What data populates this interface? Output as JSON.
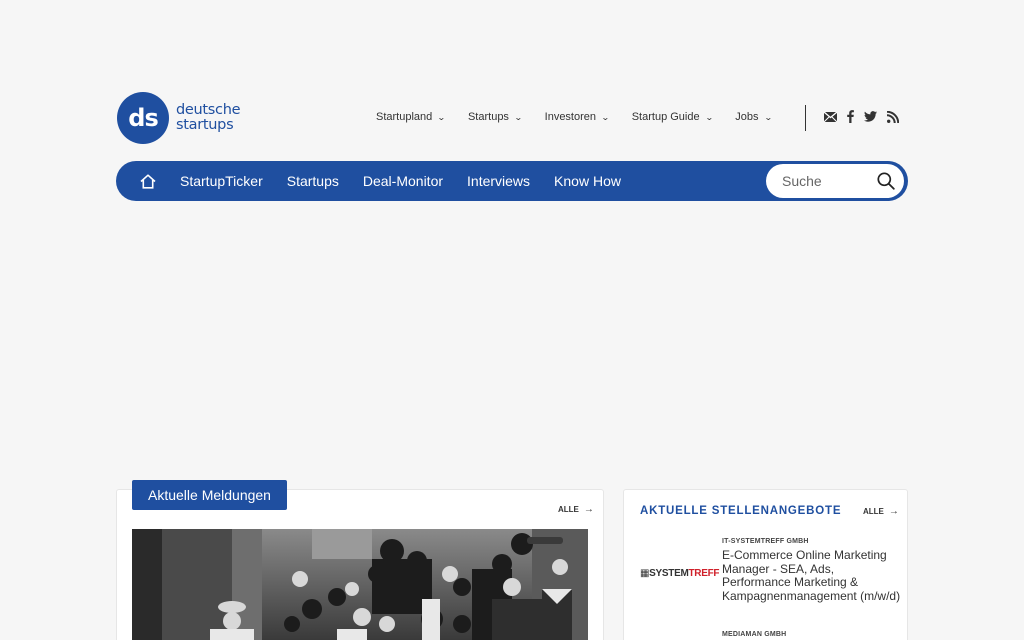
{
  "logo": {
    "mark": "ds",
    "line1": "deutsche",
    "line2": "startups"
  },
  "topnav": [
    {
      "label": "Startupland"
    },
    {
      "label": "Startups"
    },
    {
      "label": "Investoren"
    },
    {
      "label": "Startup Guide"
    },
    {
      "label": "Jobs"
    }
  ],
  "social_icons": [
    "mail-icon",
    "facebook-icon",
    "twitter-icon",
    "rss-icon"
  ],
  "mainnav": {
    "home_icon": "home-icon",
    "items": [
      "StartupTicker",
      "Startups",
      "Deal-Monitor",
      "Interviews",
      "Know How"
    ],
    "search_placeholder": "Suche"
  },
  "news": {
    "badge": "Aktuelle Meldungen",
    "all_link": "ALLE"
  },
  "jobs": {
    "title": "AKTUELLE STELLENANGEBOTE",
    "all_link": "ALLE",
    "items": [
      {
        "company": "IT-SYSTEMTREFF GMBH",
        "logo_text_a": "SYSTEM",
        "logo_text_b": "TREFF",
        "title": "E-Commerce Online Marketing Manager - SEA, Ads, Performance Marketing & Kampagnenmanagement (m/w/d)"
      },
      {
        "company": "MEDIAMAN GMBH"
      }
    ]
  },
  "colors": {
    "brand": "#1f4fa0",
    "background": "#f6f6f6",
    "accent_red": "#d0202a"
  }
}
